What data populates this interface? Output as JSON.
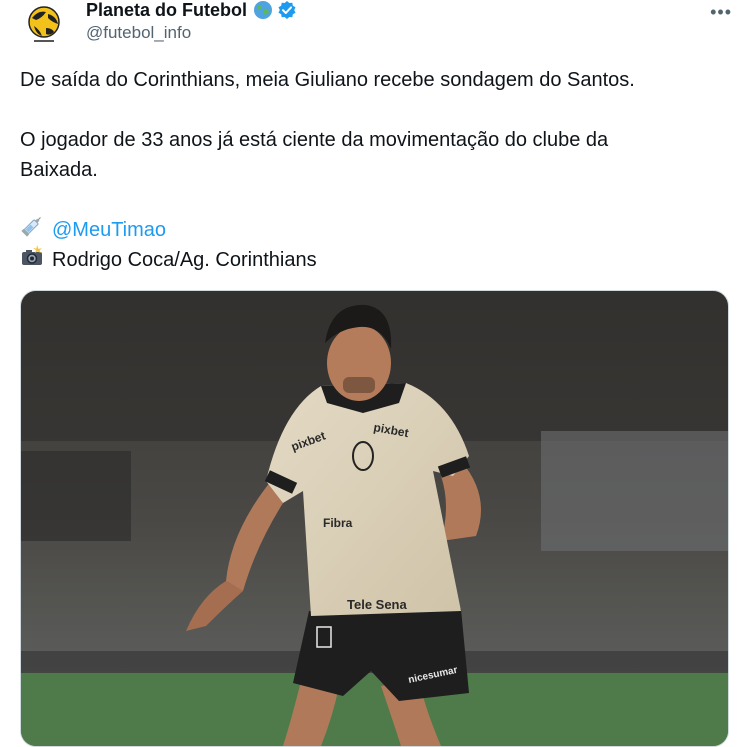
{
  "tweet": {
    "author_name": "Planeta do Futebol",
    "author_handle": "@futebol_info",
    "more_label": "•••",
    "line1": "De saída do Corinthians, meia Giuliano recebe sondagem do Santos.",
    "line2a": "O jogador de 33 anos já está ciente da movimentação do clube da",
    "line2b": "Baixada.",
    "source_mention": "@MeuTimao",
    "photo_credit": "Rodrigo Coca/Ag. Corinthians",
    "photo_alt": "Footballer in beige Corinthians shirt with sponsors pixbet, Ultrafarma, Tele Sena, nicesumar",
    "shirt_text": [
      "pixbet",
      "pixbet",
      "Fibra",
      "Tele Sena",
      "nicesumar"
    ]
  },
  "colors": {
    "link": "#1d9bf0",
    "verified": "#1d9bf0",
    "muted": "#536471"
  },
  "icons": [
    "avatar-logo",
    "globe-icon",
    "verified-badge-icon",
    "more-icon",
    "syringe-icon",
    "camera-flash-icon"
  ]
}
